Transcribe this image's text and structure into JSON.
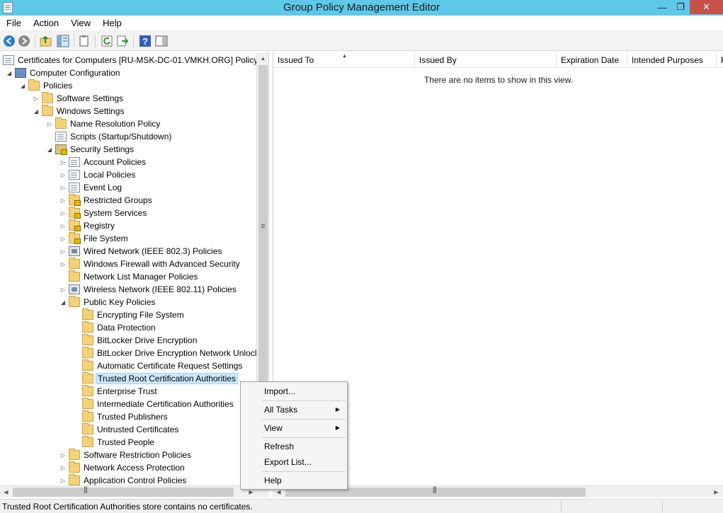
{
  "window": {
    "title": "Group Policy Management Editor"
  },
  "menu": {
    "file": "File",
    "action": "Action",
    "view": "View",
    "help": "Help"
  },
  "toolbar": {
    "buttons": [
      "back-icon",
      "forward-icon",
      "up-folder-icon",
      "show-hide-tree-icon",
      "properties-icon",
      "refresh-icon",
      "export-list-icon",
      "help-icon",
      "show-hide-action-pane-icon"
    ]
  },
  "tree": {
    "root": "Certificates for Computers [RU-MSK-DC-01.VMKH.ORG] Policy",
    "computer_config": "Computer Configuration",
    "policies": "Policies",
    "software_settings": "Software Settings",
    "windows_settings": "Windows Settings",
    "name_resolution": "Name Resolution Policy",
    "scripts": "Scripts (Startup/Shutdown)",
    "security_settings": "Security Settings",
    "account_policies": "Account Policies",
    "local_policies": "Local Policies",
    "event_log": "Event Log",
    "restricted_groups": "Restricted Groups",
    "system_services": "System Services",
    "registry": "Registry",
    "file_system": "File System",
    "wired_network": "Wired Network (IEEE 802.3) Policies",
    "windows_firewall": "Windows Firewall with Advanced Security",
    "network_list_manager": "Network List Manager Policies",
    "wireless_network": "Wireless Network (IEEE 802.11) Policies",
    "public_key_policies": "Public Key Policies",
    "encrypting_file_system": "Encrypting File System",
    "data_protection": "Data Protection",
    "bitlocker": "BitLocker Drive Encryption",
    "bitlocker_network_unlock": "BitLocker Drive Encryption Network Unlocl",
    "auto_cert_request": "Automatic Certificate Request Settings",
    "trusted_root": "Trusted Root Certification Authorities",
    "enterprise_trust": "Enterprise Trust",
    "intermediate_ca": "Intermediate Certification Authorities",
    "trusted_publishers": "Trusted Publishers",
    "untrusted_certificates": "Untrusted Certificates",
    "trusted_people": "Trusted People",
    "software_restriction": "Software Restriction Policies",
    "network_access_protection": "Network Access Protection",
    "application_control": "Application Control Policies"
  },
  "list": {
    "columns": {
      "issued_to": "Issued To",
      "issued_by": "Issued By",
      "expiration": "Expiration Date",
      "purposes": "Intended Purposes",
      "friendly": "F"
    },
    "empty_message": "There are no items to show in this view."
  },
  "context_menu": {
    "import": "Import...",
    "all_tasks": "All Tasks",
    "view": "View",
    "refresh": "Refresh",
    "export_list": "Export List...",
    "help": "Help"
  },
  "status": {
    "text": "Trusted Root Certification Authorities store contains no certificates."
  }
}
